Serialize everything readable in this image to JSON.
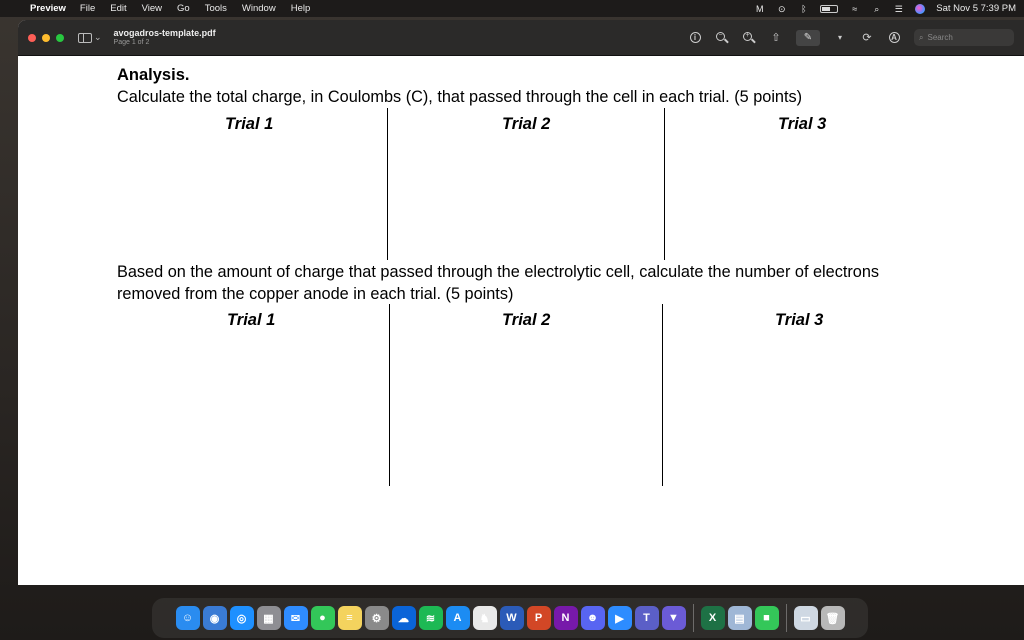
{
  "menubar": {
    "app": "Preview",
    "items": [
      "File",
      "Edit",
      "View",
      "Go",
      "Tools",
      "Window",
      "Help"
    ],
    "datetime": "Sat Nov 5  7:39 PM"
  },
  "toolbar": {
    "doc_name": "avogadros-template.pdf",
    "page_info": "Page 1 of 2",
    "search_placeholder": "Search"
  },
  "document": {
    "section_title": "Analysis.",
    "question1": "Calculate the total charge, in Coulombs (C), that passed through the cell in each trial. (5 points)",
    "q1_trials": [
      "Trial 1",
      "Trial 2",
      "Trial 3"
    ],
    "question2_line1": "Based on the amount of charge that passed through the electrolytic cell, calculate the number of electrons",
    "question2_line2": "removed from the copper anode in each trial. (5 points)",
    "q2_trials": [
      "Trial 1",
      "Trial 2",
      "Trial 3"
    ]
  },
  "dock": {
    "apps": [
      {
        "name": "finder-icon",
        "color": "#2a8cf0",
        "glyph": "☺"
      },
      {
        "name": "network-icon",
        "color": "#3a7bd5",
        "glyph": "◉"
      },
      {
        "name": "safari-icon",
        "color": "#1e90ff",
        "glyph": "◎"
      },
      {
        "name": "launchpad-icon",
        "color": "#8e8e93",
        "glyph": "▦"
      },
      {
        "name": "mail-icon",
        "color": "#2f8cff",
        "glyph": "✉"
      },
      {
        "name": "messages-icon",
        "color": "#33c759",
        "glyph": "●"
      },
      {
        "name": "notes-icon",
        "color": "#f4d35e",
        "glyph": "≡"
      },
      {
        "name": "system-settings-icon",
        "color": "#8a8a8a",
        "glyph": "⚙"
      },
      {
        "name": "onedrive-icon",
        "color": "#0a64d8",
        "glyph": "☁"
      },
      {
        "name": "spotify-icon",
        "color": "#1db954",
        "glyph": "≋"
      },
      {
        "name": "app-store-icon",
        "color": "#1c8cf3",
        "glyph": "A"
      },
      {
        "name": "kindle-icon",
        "color": "#e9e9e9",
        "glyph": "♞"
      },
      {
        "name": "word-icon",
        "color": "#2b5bb8",
        "glyph": "W"
      },
      {
        "name": "powerpoint-icon",
        "color": "#d24726",
        "glyph": "P"
      },
      {
        "name": "onenote-icon",
        "color": "#7719aa",
        "glyph": "N"
      },
      {
        "name": "discord-icon",
        "color": "#5865f2",
        "glyph": "☻"
      },
      {
        "name": "zoom-icon",
        "color": "#2d8cff",
        "glyph": "▶"
      },
      {
        "name": "teams-icon",
        "color": "#5b5fc7",
        "glyph": "T"
      },
      {
        "name": "vpn-icon",
        "color": "#6b5bd6",
        "glyph": "▼"
      },
      {
        "name": "excel-icon",
        "color": "#1e7145",
        "glyph": "X"
      },
      {
        "name": "preview-icon",
        "color": "#9fb7d6",
        "glyph": "▤"
      },
      {
        "name": "facetime-icon",
        "color": "#34c759",
        "glyph": "■"
      },
      {
        "name": "downloads-icon",
        "color": "#cfd8e3",
        "glyph": "▭"
      },
      {
        "name": "trash-icon",
        "color": "#b8b8b8",
        "glyph": "🗑"
      }
    ]
  },
  "colors": {
    "menubar_bg": "#1d1b1a",
    "toolbar_bg": "#2b2a29",
    "traffic_red": "#fe5f57",
    "traffic_yellow": "#febc2e",
    "traffic_green": "#28c840"
  }
}
